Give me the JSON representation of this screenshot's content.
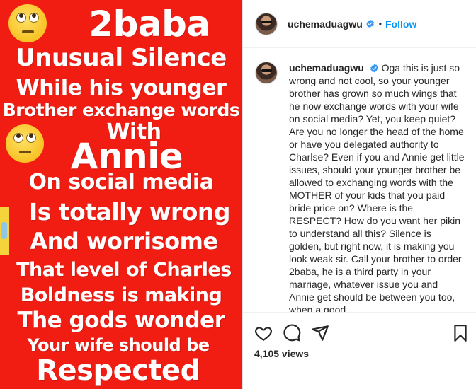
{
  "post_image": {
    "lines": [
      "2baba",
      "Unusual  Silence",
      "While his younger",
      "Brother exchange words",
      "With",
      "Annie",
      "On social media",
      "Is totally wrong",
      "And worrisome",
      "That level of Charles",
      "Boldness is making",
      "The gods wonder",
      "Your wife should be",
      "Respected"
    ],
    "background_color": "#f21d12",
    "emoji": "face-with-rolling-eyes"
  },
  "header": {
    "username": "uchemaduagwu",
    "separator": "•",
    "follow_label": "Follow"
  },
  "caption": {
    "username": "uchemaduagwu",
    "text": "Oga this is just so wrong and not cool, so your younger brother has grown so much wings that he now exchange words with your wife on social media? Yet, you keep quiet? Are you no longer the head of the home or have you delegated authority to Charlse? Even if you and Annie get little issues, should your younger brother be allowed to exchanging words with the MOTHER of your kids that you paid bride price on? Where is the RESPECT? How do you want her pikin to understand all this? Silence is golden, but right now, it is making you look weak sir. Call your brother to order 2baba, he is a third party in your marriage, whatever issue you and Annie get should be between you too, when a good"
  },
  "actions": {
    "views": "4,105 views"
  },
  "colors": {
    "accent": "#0095f6",
    "text": "#262626",
    "verified": "#3897f0"
  }
}
